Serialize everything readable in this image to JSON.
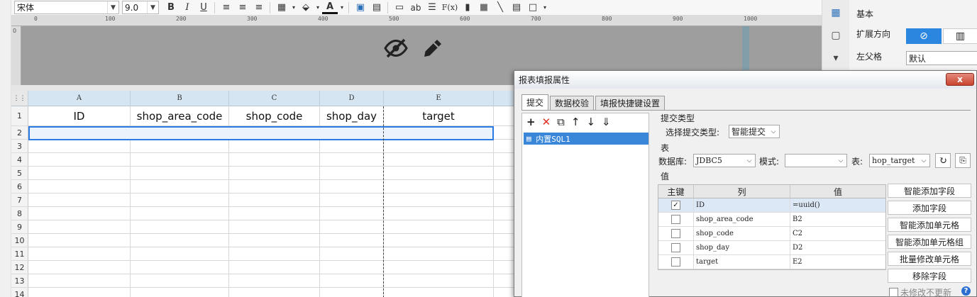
{
  "toolbar": {
    "font_name": "宋体",
    "font_size": "9.0",
    "buttons": [
      "B",
      "I",
      "U",
      "ab",
      "F(x)",
      "A"
    ]
  },
  "ruler": {
    "ticks": [
      "0",
      "100",
      "200",
      "300",
      "400",
      "500",
      "600",
      "700",
      "800",
      "900",
      "1000"
    ],
    "vertical_zero": "0"
  },
  "sheet": {
    "columns": [
      "A",
      "B",
      "C",
      "D",
      "E"
    ],
    "rows": [
      "1",
      "2",
      "3",
      "4",
      "5",
      "6",
      "7",
      "8",
      "9",
      "10",
      "11",
      "12",
      "13",
      "14"
    ],
    "row1_cells": [
      "ID",
      "shop_area_code",
      "shop_code",
      "shop_day",
      "target"
    ]
  },
  "property_panel": {
    "section": "基本",
    "expand_label": "扩展方向",
    "left_parent_label": "左父格",
    "left_parent_value": "默认"
  },
  "dialog": {
    "title": "报表填报属性",
    "close_label": "x",
    "tabs": [
      "提交",
      "数据校验",
      "填报快捷键设置"
    ],
    "left_item": "内置SQL1",
    "submit_type_section": "提交类型",
    "submit_type_label": "选择提交类型:",
    "submit_type_value": "智能提交",
    "table_section": "表",
    "db_label": "数据库:",
    "db_value": "JDBC5",
    "mode_label": "模式:",
    "mode_value": "",
    "table_label": "表:",
    "table_value": "hop_target",
    "value_section": "值",
    "table_headers": [
      "主键",
      "列",
      "值"
    ],
    "rows": [
      {
        "key": true,
        "column": "ID",
        "value": "=uuid()"
      },
      {
        "key": false,
        "column": "shop_area_code",
        "value": "B2"
      },
      {
        "key": false,
        "column": "shop_code",
        "value": "C2"
      },
      {
        "key": false,
        "column": "shop_day",
        "value": "D2"
      },
      {
        "key": false,
        "column": "target",
        "value": "E2"
      }
    ],
    "side_buttons": [
      "智能添加字段",
      "添加字段",
      "智能添加单元格",
      "智能添加单元格组",
      "批量修改单元格",
      "移除字段"
    ],
    "unmodified_label": "未修改不更新",
    "help": "?"
  }
}
